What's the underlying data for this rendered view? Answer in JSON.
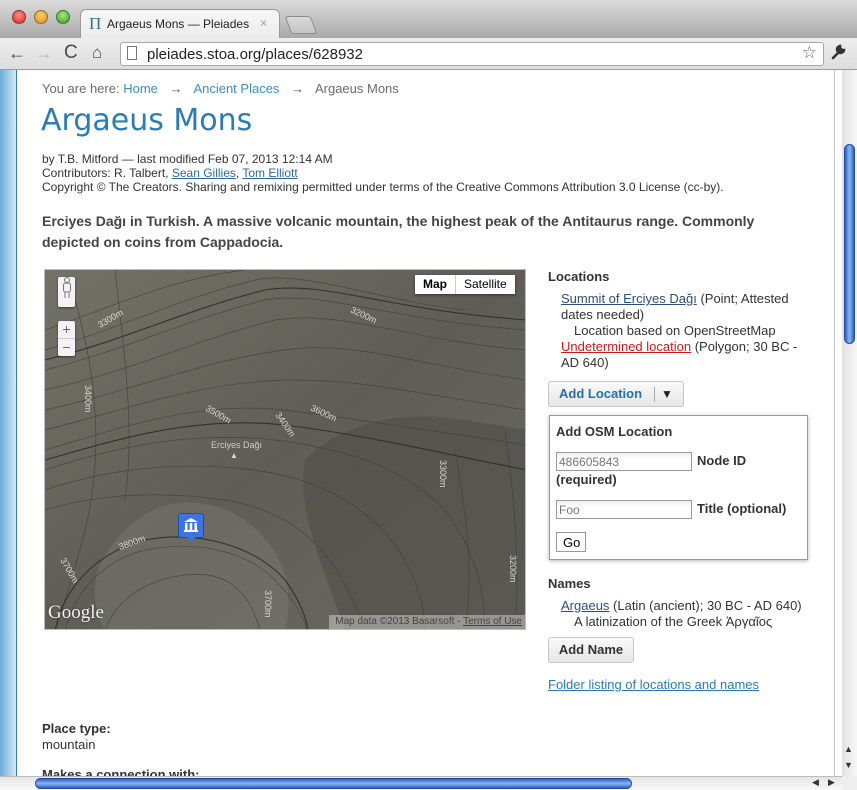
{
  "browser": {
    "tab_title": "Argaeus Mons — Pleiades",
    "tab_favicon": "Π",
    "url": "pleiades.stoa.org/places/628932",
    "icons": {
      "back": "←",
      "forward": "→",
      "reload": "C",
      "home": "⌂",
      "star": "☆",
      "wrench": "🔧",
      "close_tab": "×"
    }
  },
  "breadcrumb": {
    "prefix": "You are here:",
    "items": [
      "Home",
      "Ancient Places",
      "Argaeus Mons"
    ],
    "separator": "→"
  },
  "page": {
    "title": "Argaeus Mons",
    "byline": "by T.B. Mitford — last modified Feb 07, 2013 12:14 AM",
    "contributors_label": "Contributors: R. Talbert,",
    "contributors_links": [
      "Sean Gillies",
      "Tom Elliott"
    ],
    "copyright": "Copyright © The Creators. Sharing and remixing permitted under terms of the Creative Commons Attribution 3.0 License (cc-by).",
    "description": "Erciyes Dağı in Turkish. A massive volcanic mountain, the highest peak of the Antitaurus range. Commonly depicted on coins from Cappadocia."
  },
  "map": {
    "type_buttons": [
      "Map",
      "Satellite"
    ],
    "selected_type": "Map",
    "zoom_in": "+",
    "zoom_out": "−",
    "contour_labels": [
      "3300m",
      "3200m",
      "3400m",
      "3600m",
      "3500m",
      "3400m",
      "3300m",
      "3800m",
      "3700m",
      "3700m",
      "3200m"
    ],
    "peak_label": "Erciyes Dağı",
    "logo": "Google",
    "attribution": "Map data ©2013 Basarsoft -",
    "terms_link": "Terms of Use"
  },
  "locations": {
    "heading": "Locations",
    "items": [
      {
        "link": "Summit of Erciyes Dağı",
        "detail": " (Point; Attested dates needed)",
        "note": "Location based on OpenStreetMap",
        "color": "#2b4f7a"
      },
      {
        "link": "Undetermined location",
        "detail": " (Polygon; 30 BC - AD 640)",
        "note": "",
        "color": "#cc1a1a"
      }
    ],
    "add_button": "Add Location",
    "add_caret": "▼"
  },
  "osm_form": {
    "title": "Add OSM Location",
    "node_placeholder": "486605843",
    "node_label": "Node ID",
    "node_required": "(required)",
    "title_placeholder": "Foo",
    "title_label": "Title (optional)",
    "go": "Go"
  },
  "names": {
    "heading": "Names",
    "items": [
      {
        "link": "Argaeus",
        "detail": " (Latin (ancient); 30 BC - AD 640)",
        "note": "A latinization of the Greek Ἀργαῖος"
      }
    ],
    "add_button": "Add Name",
    "folder_link": "Folder listing of locations and names"
  },
  "place_type": {
    "label": "Place type:",
    "value": "mountain"
  },
  "connections": {
    "label": "Makes a connection with:"
  }
}
